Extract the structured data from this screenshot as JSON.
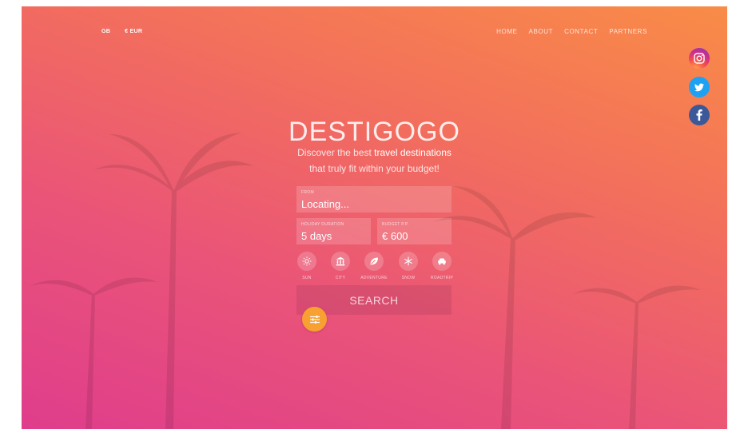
{
  "locale": {
    "country": "GB",
    "currency": "€ EUR"
  },
  "nav": {
    "items": [
      "HOME",
      "ABOUT",
      "CONTACT",
      "PARTNERS"
    ]
  },
  "brand": {
    "title": "DESTIGOGO"
  },
  "tagline": {
    "line1_prefix": "Discover the best ",
    "line1_highlight": "travel destinations",
    "line2": "that truly fit within your budget!"
  },
  "form": {
    "from": {
      "label": "FROM",
      "value": "Locating..."
    },
    "duration": {
      "label": "HOLIDAY DURATION",
      "value": "5 days"
    },
    "budget": {
      "label": "BUDGET P.P.",
      "value": "€ 600"
    },
    "categories": [
      {
        "label": "SUN",
        "icon": "sun-icon"
      },
      {
        "label": "CITY",
        "icon": "landmark-icon"
      },
      {
        "label": "ADVENTURE",
        "icon": "leaf-icon"
      },
      {
        "label": "SNOW",
        "icon": "snowflake-icon"
      },
      {
        "label": "ROADTRIP",
        "icon": "car-icon"
      }
    ],
    "search_label": "SEARCH"
  },
  "social": [
    "instagram-icon",
    "twitter-icon",
    "facebook-icon"
  ],
  "colors": {
    "gradient_top": "#f98c47",
    "gradient_bottom": "#df3d8c",
    "accent": "#f8a032"
  }
}
